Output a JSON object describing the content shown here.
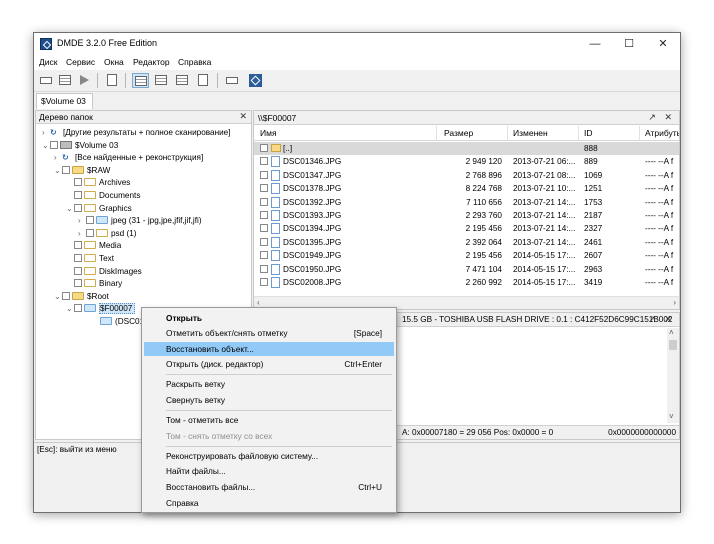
{
  "window": {
    "title": "DMDE 3.2.0 Free Edition"
  },
  "window_controls": {
    "minimize": "—",
    "maximize": "☐",
    "close": "✕"
  },
  "menubar": [
    "Диск",
    "Сервис",
    "Окна",
    "Редактор",
    "Справка"
  ],
  "tab": {
    "label": "$Volume 03"
  },
  "left_pane": {
    "title": "Дерево папок",
    "close": "✕",
    "tree": [
      {
        "exp": "›",
        "icon": "search",
        "label": "[Другие результаты + полное сканирование]"
      },
      {
        "exp": "⌄",
        "icon": "drive",
        "label": "$Volume 03"
      },
      {
        "exp": "›",
        "icon": "search",
        "label": "[Все найденные + реконструкция]"
      },
      {
        "exp": "⌄",
        "icon": "folder",
        "label": "$RAW"
      },
      {
        "exp": "",
        "icon": "folder-hollow",
        "label": "Archives"
      },
      {
        "exp": "",
        "icon": "folder-hollow",
        "label": "Documents"
      },
      {
        "exp": "⌄",
        "icon": "folder-hollow",
        "label": "Graphics"
      },
      {
        "exp": "›",
        "icon": "folder-blue",
        "label": "jpeg (31 - jpg,jpe,jfif,jif,jfi)"
      },
      {
        "exp": "›",
        "icon": "folder-hollow",
        "label": "psd (1)"
      },
      {
        "exp": "",
        "icon": "folder-hollow",
        "label": "Media"
      },
      {
        "exp": "",
        "icon": "folder-hollow",
        "label": "Text"
      },
      {
        "exp": "",
        "icon": "folder-hollow",
        "label": "DiskImages"
      },
      {
        "exp": "",
        "icon": "folder-hollow",
        "label": "Binary"
      },
      {
        "exp": "⌄",
        "icon": "folder",
        "label": "$Root"
      },
      {
        "exp": "⌄",
        "icon": "folder-blue",
        "label": "$F00007"
      },
      {
        "exp": "",
        "icon": "folder-blue",
        "label": "(DSC0134"
      }
    ]
  },
  "right_pane": {
    "path": "\\\\$F00007",
    "controls": "↗ ✕",
    "columns": {
      "name": "Имя",
      "size": "Размер",
      "modified": "Изменен",
      "id": "ID",
      "attrs": "Атрибуты"
    },
    "rows": [
      {
        "name": "[..]",
        "size": "",
        "modified": "",
        "id": "888",
        "attrs": "",
        "up": true
      },
      {
        "name": "DSC01346.JPG",
        "size": "2 949 120",
        "modified": "2013-07-21 06:...",
        "id": "889",
        "attrs": "---- --A f"
      },
      {
        "name": "DSC01347.JPG",
        "size": "2 768 896",
        "modified": "2013-07-21 08:...",
        "id": "1069",
        "attrs": "---- --A f"
      },
      {
        "name": "DSC01378.JPG",
        "size": "8 224 768",
        "modified": "2013-07-21 10:...",
        "id": "1251",
        "attrs": "---- --A f"
      },
      {
        "name": "DSC01392.JPG",
        "size": "7 110 656",
        "modified": "2013-07-21 14:...",
        "id": "1753",
        "attrs": "---- --A f"
      },
      {
        "name": "DSC01393.JPG",
        "size": "2 293 760",
        "modified": "2013-07-21 14:...",
        "id": "2187",
        "attrs": "---- --A f"
      },
      {
        "name": "DSC01394.JPG",
        "size": "2 195 456",
        "modified": "2013-07-21 14:...",
        "id": "2327",
        "attrs": "---- --A f"
      },
      {
        "name": "DSC01395.JPG",
        "size": "2 392 064",
        "modified": "2013-07-21 14:...",
        "id": "2461",
        "attrs": "---- --A f"
      },
      {
        "name": "DSC01949.JPG",
        "size": "2 195 456",
        "modified": "2014-05-15 17:...",
        "id": "2607",
        "attrs": "---- --A f"
      },
      {
        "name": "DSC01950.JPG",
        "size": "7 471 104",
        "modified": "2014-05-15 17:...",
        "id": "2963",
        "attrs": "---- --A f"
      },
      {
        "name": "DSC02008.JPG",
        "size": "2 260 992",
        "modified": "2014-05-15 17:...",
        "id": "3419",
        "attrs": "---- --A f"
      }
    ],
    "scroll_left": "‹",
    "scroll_right": "›"
  },
  "info_pane": {
    "header": "15.5 GB - TOSHIBA USB FLASH DRIVE : 0.1 : C412F52D6C99C151B002",
    "controls": "↗ ✕",
    "status_left": "A: 0x00007180 = 29 056  Pos: 0x0000 = 0",
    "status_right": "0x0000000000000",
    "scroll_up": "˄",
    "scroll_down": "˅"
  },
  "statusbar": {
    "text": "[Esc]: выйти из меню"
  },
  "context_menu": {
    "items": [
      {
        "label": "Открыть",
        "shortcut": "",
        "bold": true
      },
      {
        "label": "Отметить объект/снять отметку",
        "shortcut": "[Space]"
      },
      {
        "label": "Восстановить объект...",
        "shortcut": "",
        "hover": true
      },
      {
        "label": "Открыть (диск. редактор)",
        "shortcut": "Ctrl+Enter"
      },
      {
        "label": "Раскрыть ветку",
        "shortcut": ""
      },
      {
        "label": "Свернуть ветку",
        "shortcut": ""
      },
      {
        "label": "Том - отметить все",
        "shortcut": ""
      },
      {
        "label": "Том - снять отметку со всех",
        "shortcut": "",
        "disabled": true
      },
      {
        "label": "Реконструировать файловую систему...",
        "shortcut": ""
      },
      {
        "label": "Найти файлы...",
        "shortcut": ""
      },
      {
        "label": "Восстановить файлы...",
        "shortcut": "Ctrl+U"
      },
      {
        "label": "Справка",
        "shortcut": ""
      }
    ]
  },
  "colors": {
    "accent": "#91c9f7",
    "selection": "#cde6fa",
    "highlight_row": "#d9d9d9",
    "brand": "#1e4e8c"
  }
}
